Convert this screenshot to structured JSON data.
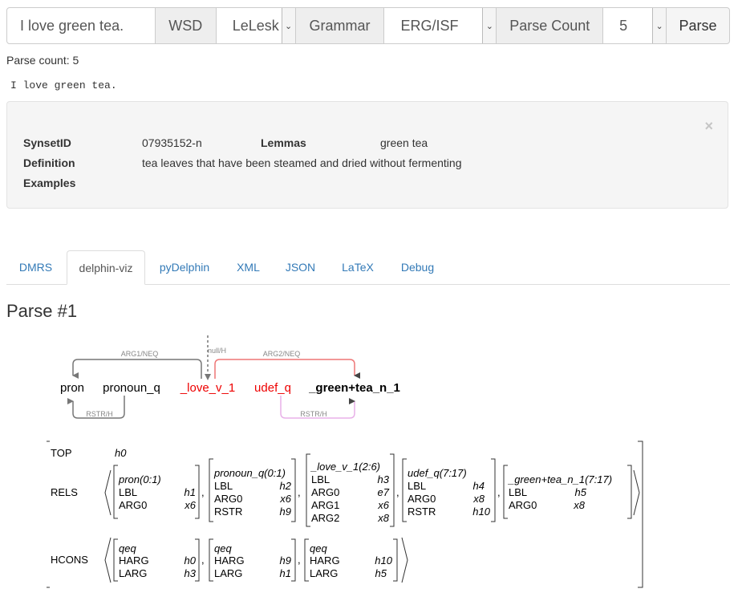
{
  "toolbar": {
    "input_value": "I love green tea.",
    "wsd_label": "WSD",
    "wsd_select": "LeLesk",
    "grammar_label": "Grammar",
    "grammar_select": "ERG/ISF",
    "parse_count_label": "Parse Count",
    "parse_count_select": "5",
    "parse_button": "Parse"
  },
  "parse_count_text": "Parse count: 5",
  "sentence": "I love green tea.",
  "synset": {
    "synsetid_label": "SynsetID",
    "synsetid_value": "07935152-n",
    "lemmas_label": "Lemmas",
    "lemmas_value": "green tea",
    "definition_label": "Definition",
    "definition_value": "tea leaves that have been steamed and dried without fermenting",
    "examples_label": "Examples",
    "close": "×"
  },
  "tabs": [
    {
      "label": "DMRS"
    },
    {
      "label": "delphin-viz"
    },
    {
      "label": "pyDelphin"
    },
    {
      "label": "XML"
    },
    {
      "label": "JSON"
    },
    {
      "label": "LaTeX"
    },
    {
      "label": "Debug"
    }
  ],
  "parse_title": "Parse #1",
  "dmrs": {
    "nodes": [
      "pron",
      "pronoun_q",
      "_love_v_1",
      "udef_q",
      "_green+tea_n_1"
    ],
    "links": {
      "arg1": "ARG1/NEQ",
      "arg2": "ARG2/NEQ",
      "top": "null/H",
      "rstr1": "RSTR/H",
      "rstr2": "RSTR/H"
    }
  },
  "mrs": {
    "top_label": "TOP",
    "top_value": "h0",
    "rels_label": "RELS",
    "hcons_label": "HCONS",
    "rels": [
      {
        "pred": "pron",
        "span": "(0:1)",
        "roles": [
          [
            "LBL",
            "h1"
          ],
          [
            "ARG0",
            "x6"
          ]
        ]
      },
      {
        "pred": "pronoun_q",
        "span": "(0:1)",
        "roles": [
          [
            "LBL",
            "h2"
          ],
          [
            "ARG0",
            "x6"
          ],
          [
            "RSTR",
            "h9"
          ]
        ]
      },
      {
        "pred": "_love_v_1",
        "span": "(2:6)",
        "roles": [
          [
            "LBL",
            "h3"
          ],
          [
            "ARG0",
            "e7"
          ],
          [
            "ARG1",
            "x6"
          ],
          [
            "ARG2",
            "x8"
          ]
        ]
      },
      {
        "pred": "udef_q",
        "span": "(7:17)",
        "roles": [
          [
            "LBL",
            "h4"
          ],
          [
            "ARG0",
            "x8"
          ],
          [
            "RSTR",
            "h10"
          ]
        ]
      },
      {
        "pred": "_green+tea_n_1",
        "span": "(7:17)",
        "roles": [
          [
            "LBL",
            "h5"
          ],
          [
            "ARG0",
            "x8"
          ]
        ]
      }
    ],
    "hcons": [
      {
        "rel": "qeq",
        "roles": [
          [
            "HARG",
            "h0"
          ],
          [
            "LARG",
            "h3"
          ]
        ]
      },
      {
        "rel": "qeq",
        "roles": [
          [
            "HARG",
            "h9"
          ],
          [
            "LARG",
            "h1"
          ]
        ]
      },
      {
        "rel": "qeq",
        "roles": [
          [
            "HARG",
            "h10"
          ],
          [
            "LARG",
            "h5"
          ]
        ]
      }
    ],
    "comma": ","
  },
  "colors": {
    "link": "#337ab7",
    "red": "#e00",
    "arg2_line": "#e77",
    "rstr_pink": "#e8b0e8",
    "gray_line": "#777"
  }
}
